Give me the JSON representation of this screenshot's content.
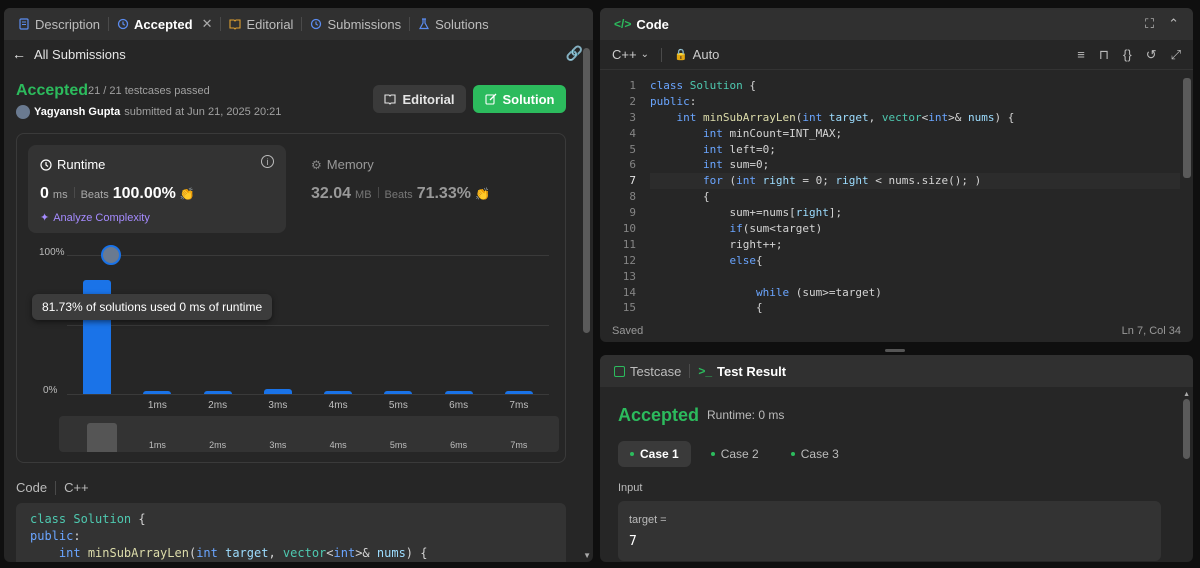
{
  "left_tabs": {
    "description": "Description",
    "accepted": "Accepted",
    "editorial": "Editorial",
    "submissions": "Submissions",
    "solutions": "Solutions"
  },
  "back": {
    "label": "All Submissions"
  },
  "result": {
    "status": "Accepted",
    "testcases": "21 / 21 testcases passed",
    "user": "Yagyansh Gupta",
    "submitted_text": "submitted at Jun 21, 2025 20:21",
    "editorial_btn": "Editorial",
    "solution_btn": "Solution"
  },
  "runtime": {
    "title": "Runtime",
    "value": "0",
    "unit": "ms",
    "beats_label": "Beats",
    "beats_value": "100.00%",
    "analyze": "Analyze Complexity"
  },
  "memory": {
    "title": "Memory",
    "value": "32.04",
    "unit": "MB",
    "beats_label": "Beats",
    "beats_value": "71.33%"
  },
  "chart_data": {
    "type": "bar",
    "categories": [
      "0ms",
      "1ms",
      "2ms",
      "3ms",
      "4ms",
      "5ms",
      "6ms",
      "7ms"
    ],
    "tick_labels": [
      "",
      "1ms",
      "2ms",
      "3ms",
      "4ms",
      "5ms",
      "6ms",
      "7ms"
    ],
    "values": [
      81.73,
      2.5,
      2.5,
      3.5,
      2.5,
      2.5,
      2.5,
      2.5
    ],
    "y_tick_labels": [
      "100%",
      "0%"
    ],
    "ylim": [
      0,
      100
    ],
    "grid": true,
    "tooltip": "81.73% of solutions used 0 ms of runtime",
    "mini_labels": [
      "1ms",
      "2ms",
      "3ms",
      "4ms",
      "5ms",
      "6ms",
      "7ms"
    ]
  },
  "code_section": {
    "label": "Code",
    "lang": "C++",
    "lines": [
      [
        [
          "ty",
          "class "
        ],
        [
          "ty",
          "Solution"
        ],
        [
          "plain",
          " {"
        ]
      ],
      [
        [
          "kw",
          "public"
        ],
        [
          "plain",
          ":"
        ]
      ],
      [
        [
          "plain",
          "    "
        ],
        [
          "kw",
          "int "
        ],
        [
          "fn",
          "minSubArrayLen"
        ],
        [
          "plain",
          "("
        ],
        [
          "kw",
          "int "
        ],
        [
          "va",
          "target"
        ],
        [
          "plain",
          ", "
        ],
        [
          "ty",
          "vector"
        ],
        [
          "plain",
          "<"
        ],
        [
          "kw",
          "int"
        ],
        [
          "plain",
          ">& "
        ],
        [
          "va",
          "nums"
        ],
        [
          "plain",
          ") {"
        ]
      ]
    ]
  },
  "editor": {
    "title": "Code",
    "lang": "C++",
    "mode": "Auto",
    "status": "Saved",
    "cursor": "Ln 7, Col 34",
    "lines": [
      [
        [
          "kw",
          "class "
        ],
        [
          "ty",
          "Solution"
        ],
        [
          "plain",
          " {"
        ]
      ],
      [
        [
          "kw",
          "public"
        ],
        [
          "plain",
          ":"
        ]
      ],
      [
        [
          "plain",
          "    "
        ],
        [
          "kw",
          "int "
        ],
        [
          "fn",
          "minSubArrayLen"
        ],
        [
          "plain",
          "("
        ],
        [
          "kw",
          "int "
        ],
        [
          "va",
          "target"
        ],
        [
          "plain",
          ", "
        ],
        [
          "ty",
          "vector"
        ],
        [
          "plain",
          "<"
        ],
        [
          "kw",
          "int"
        ],
        [
          "plain",
          ">& "
        ],
        [
          "va",
          "nums"
        ],
        [
          "plain",
          ") {"
        ]
      ],
      [
        [
          "plain",
          "        "
        ],
        [
          "kw",
          "int "
        ],
        [
          "plain",
          "minCount=INT_MAX;"
        ]
      ],
      [
        [
          "plain",
          "        "
        ],
        [
          "kw",
          "int "
        ],
        [
          "plain",
          "left=0;"
        ]
      ],
      [
        [
          "plain",
          "        "
        ],
        [
          "kw",
          "int "
        ],
        [
          "plain",
          "sum=0;"
        ]
      ],
      [
        [
          "plain",
          "        "
        ],
        [
          "kw",
          "for "
        ],
        [
          "plain",
          "("
        ],
        [
          "kw",
          "int "
        ],
        [
          "va",
          "right"
        ],
        [
          "plain",
          " = 0; "
        ],
        [
          "va",
          "right"
        ],
        [
          "plain",
          " < nums.size(); )"
        ]
      ],
      [
        [
          "plain",
          "        {"
        ]
      ],
      [
        [
          "plain",
          "            sum+=nums["
        ],
        [
          "va",
          "right"
        ],
        [
          "plain",
          "];"
        ]
      ],
      [
        [
          "plain",
          "            "
        ],
        [
          "kw",
          "if"
        ],
        [
          "plain",
          "(sum<target)"
        ]
      ],
      [
        [
          "plain",
          "            right++;"
        ]
      ],
      [
        [
          "plain",
          "            "
        ],
        [
          "kw",
          "else"
        ],
        [
          "plain",
          "{"
        ]
      ],
      [
        [
          "plain",
          ""
        ]
      ],
      [
        [
          "plain",
          "                "
        ],
        [
          "kw",
          "while "
        ],
        [
          "plain",
          "(sum>=target)"
        ]
      ],
      [
        [
          "plain",
          "                {"
        ]
      ]
    ]
  },
  "bottom": {
    "testcase_tab": "Testcase",
    "result_tab": "Test Result",
    "status": "Accepted",
    "runtime": "Runtime: 0 ms",
    "cases": [
      "Case 1",
      "Case 2",
      "Case 3"
    ],
    "input_label": "Input",
    "var_name": "target =",
    "var_value": "7"
  }
}
